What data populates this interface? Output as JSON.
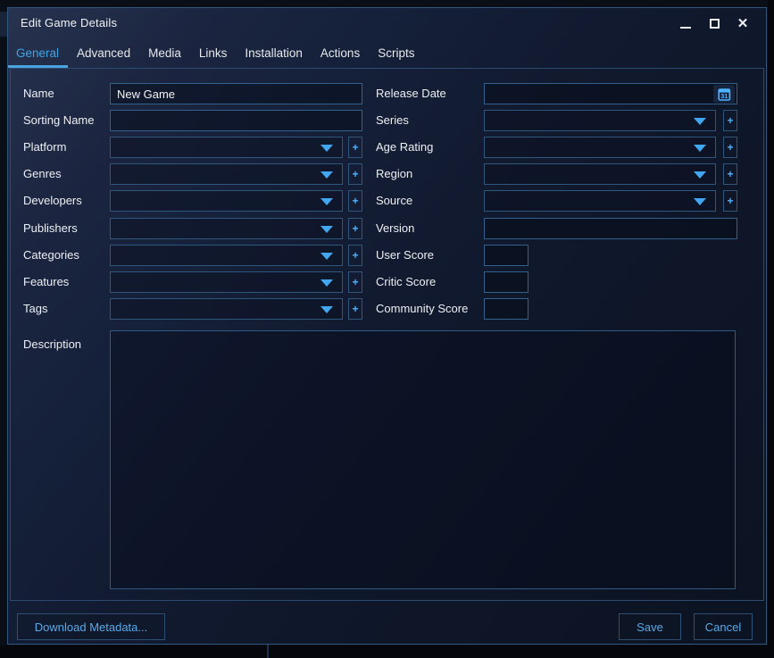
{
  "window": {
    "title": "Edit Game Details",
    "controls": {
      "minimize": "minimize",
      "maximize": "maximize",
      "close": "✕"
    }
  },
  "tabs": [
    {
      "key": "general",
      "label": "General",
      "active": true
    },
    {
      "key": "advanced",
      "label": "Advanced",
      "active": false
    },
    {
      "key": "media",
      "label": "Media",
      "active": false
    },
    {
      "key": "links",
      "label": "Links",
      "active": false
    },
    {
      "key": "installation",
      "label": "Installation",
      "active": false
    },
    {
      "key": "actions",
      "label": "Actions",
      "active": false
    },
    {
      "key": "scripts",
      "label": "Scripts",
      "active": false
    }
  ],
  "form": {
    "left": [
      {
        "key": "name",
        "label": "Name",
        "type": "text",
        "value": "New Game"
      },
      {
        "key": "sorting-name",
        "label": "Sorting Name",
        "type": "text",
        "value": ""
      },
      {
        "key": "platform",
        "label": "Platform",
        "type": "combo-add",
        "value": ""
      },
      {
        "key": "genres",
        "label": "Genres",
        "type": "combo-add",
        "value": ""
      },
      {
        "key": "developers",
        "label": "Developers",
        "type": "combo-add",
        "value": ""
      },
      {
        "key": "publishers",
        "label": "Publishers",
        "type": "combo-add",
        "value": ""
      },
      {
        "key": "categories",
        "label": "Categories",
        "type": "combo-add",
        "value": ""
      },
      {
        "key": "features",
        "label": "Features",
        "type": "combo-add",
        "value": ""
      },
      {
        "key": "tags",
        "label": "Tags",
        "type": "combo-add",
        "value": ""
      },
      {
        "key": "description",
        "label": "Description",
        "type": "textarea",
        "value": ""
      }
    ],
    "right": [
      {
        "key": "release-date",
        "label": "Release Date",
        "type": "date",
        "value": ""
      },
      {
        "key": "series",
        "label": "Series",
        "type": "combo-add",
        "value": ""
      },
      {
        "key": "age-rating",
        "label": "Age Rating",
        "type": "combo-add",
        "value": ""
      },
      {
        "key": "region",
        "label": "Region",
        "type": "combo-add",
        "value": ""
      },
      {
        "key": "source",
        "label": "Source",
        "type": "combo-add",
        "value": ""
      },
      {
        "key": "version",
        "label": "Version",
        "type": "text",
        "value": ""
      },
      {
        "key": "user-score",
        "label": "User Score",
        "type": "score",
        "value": ""
      },
      {
        "key": "critic-score",
        "label": "Critic Score",
        "type": "score",
        "value": ""
      },
      {
        "key": "community-score",
        "label": "Community Score",
        "type": "score",
        "value": ""
      }
    ]
  },
  "footer": {
    "download_metadata": "Download Metadata...",
    "save": "Save",
    "cancel": "Cancel"
  },
  "icons": {
    "add": "+",
    "dropdown": "chevron-down-triangle",
    "calendar_day": "31"
  },
  "colors": {
    "accent_blue": "#42a7f0",
    "tab_active": "#41a3e4",
    "button_text": "#58a9e8",
    "input_border": "#33608c",
    "combo_border": "#30567c",
    "window_border": "#31567e",
    "label_text": "#eef0f3"
  }
}
